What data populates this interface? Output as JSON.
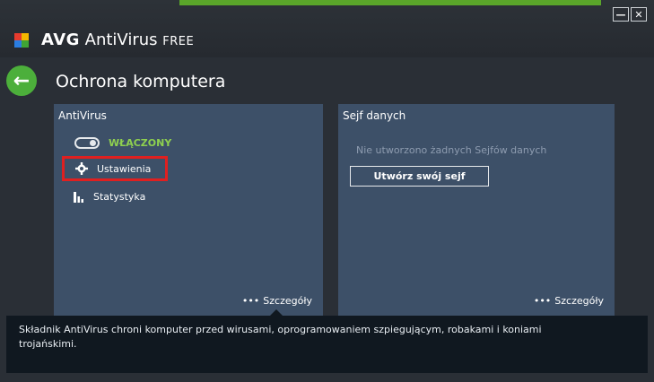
{
  "window": {
    "minimize_label": "—",
    "close_label": "✕"
  },
  "app": {
    "brand": "AVG",
    "product": "AntiVirus",
    "edition": "FREE"
  },
  "page": {
    "title": "Ochrona komputera",
    "back_icon": "←"
  },
  "antivirus": {
    "title": "AntiVirus",
    "status": "WŁĄCZONY",
    "items": [
      {
        "label": "Ustawienia",
        "icon": "gear-icon"
      },
      {
        "label": "Statystyka",
        "icon": "bar-chart-icon"
      }
    ],
    "details": "Szczegóły"
  },
  "vault": {
    "title": "Sejf danych",
    "note": "Nie utworzono żadnych Sejfów danych",
    "create_button": "Utwórz swój sejf",
    "details": "Szczegóły"
  },
  "footer": {
    "description": "Składnik AntiVirus chroni komputer przed wirusami, oprogramowaniem szpiegującym, robakami i koniami trojańskimi."
  },
  "colors": {
    "accent": "#5aa62a",
    "status_green": "#8fd14f",
    "highlight_red": "#e02020"
  }
}
